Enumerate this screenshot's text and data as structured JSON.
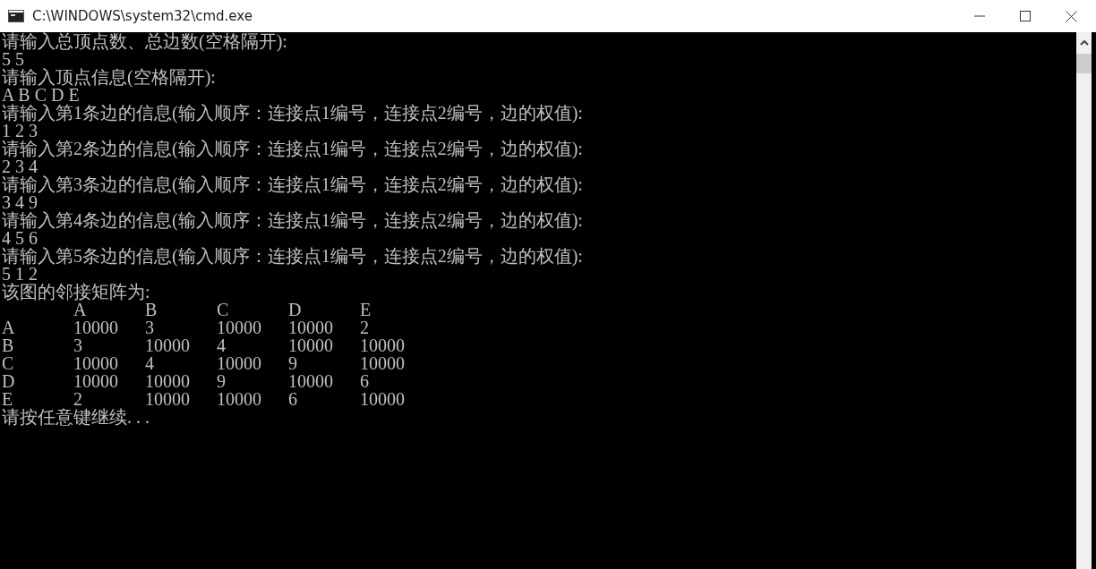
{
  "window": {
    "title": "C:\\WINDOWS\\system32\\cmd.exe"
  },
  "console": {
    "lines": [
      "请输入总顶点数、总边数(空格隔开):",
      "5 5",
      "请输入顶点信息(空格隔开):",
      "A B C D E",
      "请输入第1条边的信息(输入顺序：连接点1编号，连接点2编号，边的权值):",
      "1 2 3",
      "请输入第2条边的信息(输入顺序：连接点1编号，连接点2编号，边的权值):",
      "2 3 4",
      "请输入第3条边的信息(输入顺序：连接点1编号，连接点2编号，边的权值):",
      "3 4 9",
      "请输入第4条边的信息(输入顺序：连接点1编号，连接点2编号，边的权值):",
      "4 5 6",
      "请输入第5条边的信息(输入顺序：连接点1编号，连接点2编号，边的权值):",
      "5 1 2",
      "该图的邻接矩阵为:"
    ],
    "matrix": {
      "columns": [
        "A",
        "B",
        "C",
        "D",
        "E"
      ],
      "rows": [
        {
          "label": "A",
          "cells": [
            "10000",
            "3",
            "10000",
            "10000",
            "2"
          ]
        },
        {
          "label": "B",
          "cells": [
            "3",
            "10000",
            "4",
            "10000",
            "10000"
          ]
        },
        {
          "label": "C",
          "cells": [
            "10000",
            "4",
            "10000",
            "9",
            "10000"
          ]
        },
        {
          "label": "D",
          "cells": [
            "10000",
            "10000",
            "9",
            "10000",
            "6"
          ]
        },
        {
          "label": "E",
          "cells": [
            "2",
            "10000",
            "10000",
            "6",
            "10000"
          ]
        }
      ]
    },
    "prompt": "请按任意键继续. . ."
  }
}
